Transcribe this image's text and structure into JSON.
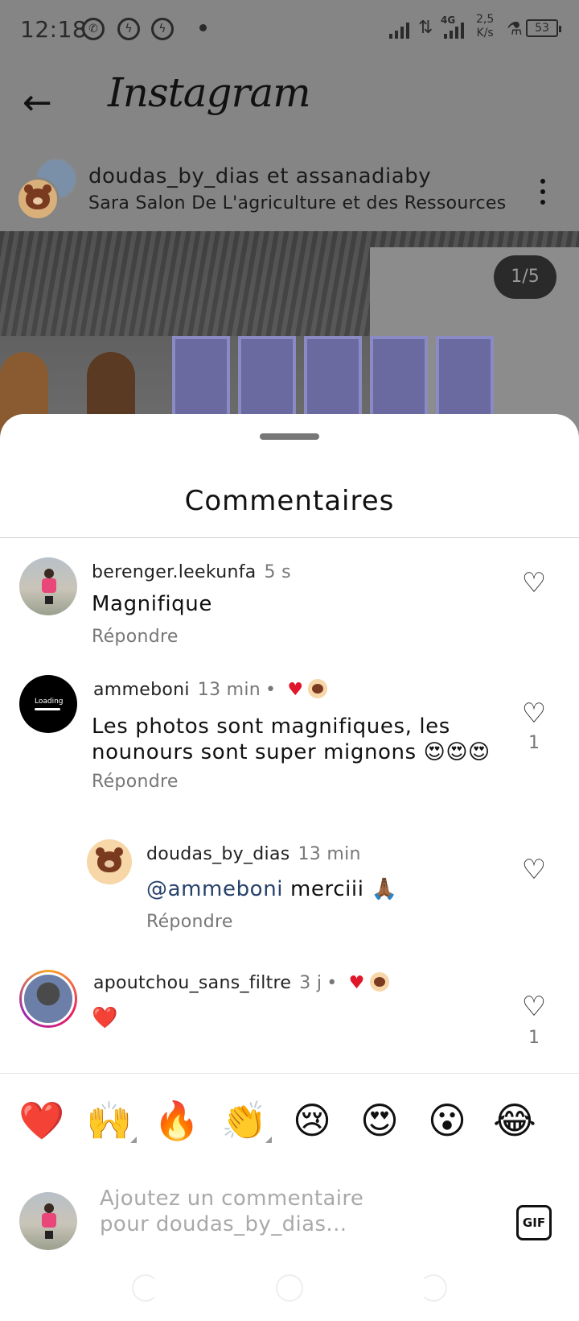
{
  "status_bar": {
    "time": "12:18",
    "app_icons": [
      "whatsapp-icon",
      "messenger-icon",
      "messenger-icon"
    ],
    "network_type": "4G",
    "speed_value": "2,5",
    "speed_unit": "K/s",
    "battery": "53"
  },
  "app": {
    "title": "Instagram",
    "back_icon": "arrow-left-icon"
  },
  "post": {
    "users": "doudas_by_dias et assanadiaby",
    "location": "Sara Salon De L'agriculture et des Ressources",
    "image_counter": "1/5"
  },
  "sheet": {
    "title": "Commentaires"
  },
  "comments": [
    {
      "user": "berenger.leekunfa",
      "time": "5 s",
      "text": "Magnifique",
      "reply_label": "Répondre",
      "like_count": ""
    },
    {
      "user": "ammeboni",
      "time": "13 min",
      "author_liked": true,
      "avatar_text": "Loading",
      "text": "Les photos sont magnifiques, les nounours sont super mignons 😍😍😍",
      "reply_label": "Répondre",
      "like_count": "1"
    },
    {
      "user": "doudas_by_dias",
      "time": "13 min",
      "mention": "@ammeboni",
      "text": " merciii 🙏🏾",
      "reply_label": "Répondre",
      "like_count": ""
    },
    {
      "user": "apoutchou_sans_filtre",
      "time": "3 j",
      "author_liked": true,
      "text": "❤️",
      "like_count": "1"
    }
  ],
  "emoji_bar": [
    "❤️",
    "🙌",
    "🔥",
    "👏",
    "😢",
    "😍",
    "😮",
    "😂"
  ],
  "composer": {
    "placeholder": "Ajoutez un commentaire pour doudas_by_dias...",
    "gif_label": "GIF"
  },
  "colors": {
    "like_red": "#e0162b",
    "mention_blue": "#26416b",
    "muted": "#777777"
  }
}
